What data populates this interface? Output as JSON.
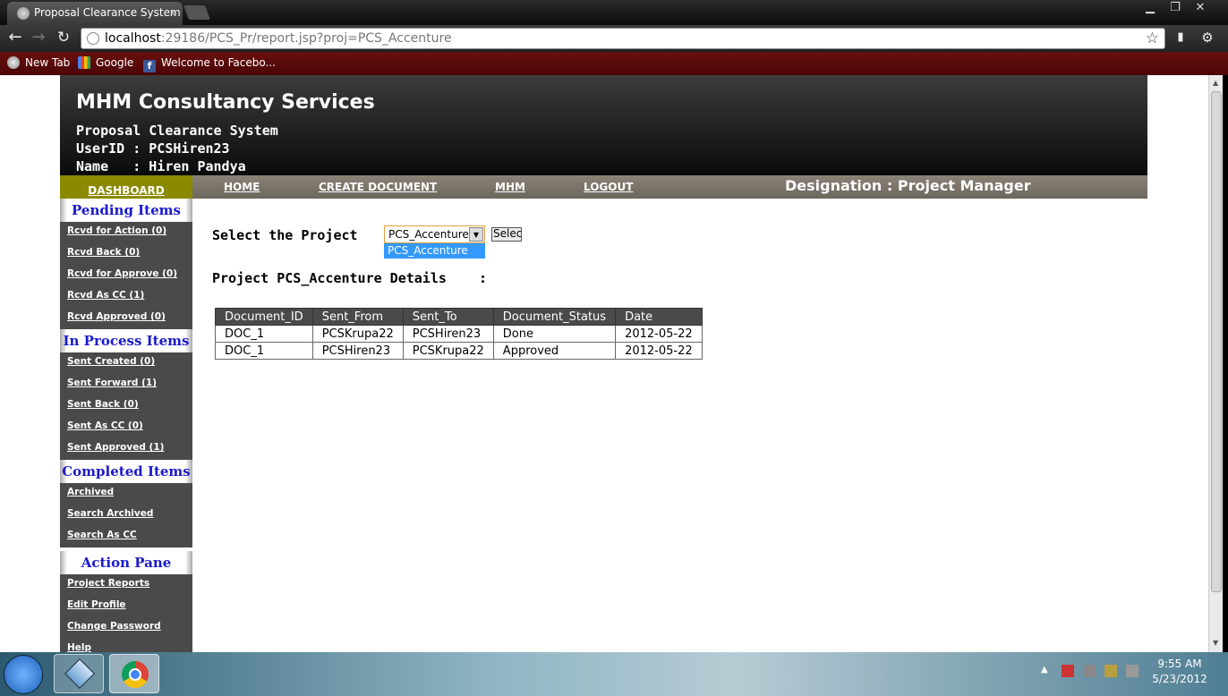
{
  "browser": {
    "tab_title": "Proposal Clearance System",
    "tab_close": "x",
    "url_host": "localhost",
    "url_rest": ":29186/PCS_Pr/report.jsp?proj=PCS_Accenture",
    "window_controls": [
      "▁",
      "❐",
      "✕"
    ],
    "bookmarks": [
      {
        "label": "New Tab",
        "icon": "chrome-icon"
      },
      {
        "label": "Google",
        "icon": "google-icon"
      },
      {
        "label": "Welcome to Facebo...",
        "icon": "facebook-icon"
      }
    ]
  },
  "header": {
    "company": "MHM Consultancy Services",
    "system": "Proposal Clearance System",
    "userid_line": "UserID : PCSHiren23",
    "name_line": "Name   : Hiren Pandya"
  },
  "nav": {
    "dashboard": "DASHBOARD",
    "home": "HOME",
    "create": "CREATE  DOCUMENT",
    "mhm": "MHM",
    "logout": "LOGOUT",
    "designation": "Designation : Project Manager"
  },
  "sidebar": {
    "pending": {
      "title": "Pending Items",
      "items": [
        "Rcvd for Action (0)",
        "Rcvd Back (0)",
        "Rcvd for Approve (0)",
        "Rcvd As CC (1)",
        "Rcvd Approved (0)"
      ]
    },
    "inprocess": {
      "title": "In Process Items",
      "items": [
        "Sent Created (0)",
        "Sent Forward (1)",
        "Sent Back (0)",
        "Sent As CC (0)",
        "Sent Approved (1)"
      ]
    },
    "completed": {
      "title": "Completed Items",
      "items": [
        "Archived",
        "Search Archived",
        "Search As CC"
      ]
    },
    "action": {
      "title": "Action Pane",
      "items": [
        "Project Reports",
        "Edit Profile",
        "Change Password",
        "Help"
      ]
    }
  },
  "main": {
    "select_label": "Select the Project    :",
    "selected_project": "PCS_Accenture",
    "dropdown_option": "PCS_Accenture",
    "select_button": "Select",
    "details_label": "Project PCS_Accenture Details    :",
    "table": {
      "headers": [
        "Document_ID",
        "Sent_From",
        "Sent_To",
        "Document_Status",
        "Date"
      ],
      "rows": [
        [
          "DOC_1",
          "PCSKrupa22",
          "PCSHiren23",
          "Done",
          "2012-05-22"
        ],
        [
          "DOC_1",
          "PCSHiren23",
          "PCSKrupa22",
          "Approved",
          "2012-05-22"
        ]
      ]
    }
  },
  "taskbar": {
    "time": "9:55 AM",
    "date": "5/23/2012"
  }
}
